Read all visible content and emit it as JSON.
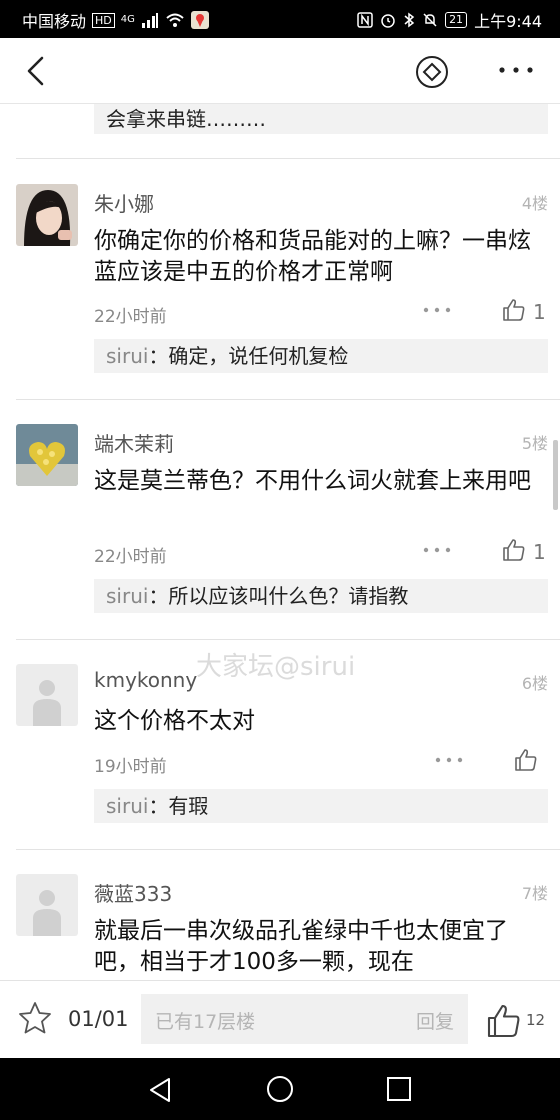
{
  "status_bar": {
    "carrier": "中国移动",
    "hd": "HD",
    "network": "4G",
    "battery": "21",
    "time": "上午9:44"
  },
  "prev_reply": {
    "text": "会拿来串链………"
  },
  "posts": [
    {
      "name": "朱小娜",
      "floor": "4楼",
      "text": "你确定你的价格和货品能对的上嘛？一串炫蓝应该是中五的价格才正常啊",
      "time": "22小时前",
      "likes": "1",
      "reply_name": "sirui",
      "reply_text": "：确定，说任何机复检"
    },
    {
      "name": "端木茉莉",
      "floor": "5楼",
      "text": "这是莫兰蒂色？不用什么词火就套上来用吧",
      "time": "22小时前",
      "likes": "1",
      "reply_name": "sirui",
      "reply_text": "：所以应该叫什么色？请指教"
    },
    {
      "name": "kmykonny",
      "floor": "6楼",
      "text": "这个价格不太对",
      "time": "19小时前",
      "likes": "",
      "reply_name": "sirui",
      "reply_text": "：有瑕"
    },
    {
      "name": "薇蓝333",
      "floor": "7楼",
      "text": "就最后一串次级品孔雀绿中千也太便宜了吧，相当于才100多一颗，现在",
      "time": "",
      "likes": "",
      "reply_name": "",
      "reply_text": ""
    }
  ],
  "watermark": "大家坛@sirui",
  "bottom_bar": {
    "pages": "01/01",
    "input_placeholder": "已有17层楼",
    "reply_label": "回复",
    "like_count": "12"
  }
}
